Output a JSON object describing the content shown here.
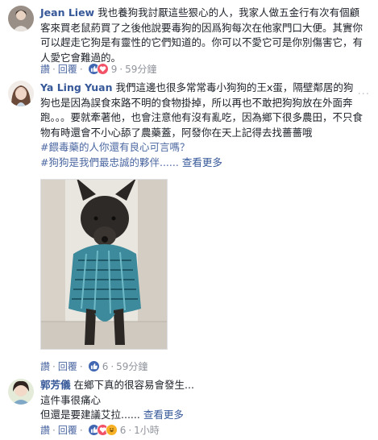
{
  "comments": [
    {
      "author": "Jean Liew",
      "text": "我也養狗我討厭這些狠心的人，我家人做五金行有次有個顧客來買老鼠葯買了之後他說要毒狗的因爲狗每次在他家門口大便。其實你可以趕走它狗是有靈性的它們知道的。你可以不愛它可是你別傷害它，有人愛它會難過的。",
      "like": "讚",
      "reply": "回覆",
      "reaction_count": "9",
      "time": "59分鐘"
    },
    {
      "author": "Ya Ling Yuan",
      "text": "我們這邊也很多常常毒小狗狗的王x蛋，隔壁鄰居的狗狗也是因為誤食來路不明的食物掛掉，所以再也不敢把狗狗放在外面奔跑。。。要就牽著他，也會注意他有沒有亂吃，因為鄉下很多農田，不只食物有時還會不小心舔了農藥蓋，阿發你在天上記得去找薔薔哦",
      "hashtag1": "#餵毒藥的人你還有良心可言嗎？",
      "hashtag2": "#狗狗是我們最忠誠的夥伴......",
      "see_more": "查看更多",
      "like": "讚",
      "reply": "回覆",
      "reaction_count": "6",
      "time": "59分鐘"
    },
    {
      "author": "郭芳儀",
      "line1": "在鄉下真的很容易會發生...",
      "line2": "這件事很痛心",
      "line3": "但還是要建議艾拉......",
      "see_more": "查看更多",
      "like": "讚",
      "reply": "回覆",
      "reaction_count": "6",
      "time": "1小時"
    }
  ],
  "menu": "···",
  "colors": {
    "link": "#365899",
    "muted": "#90949c",
    "like": "#4267b2",
    "love": "#f25268",
    "haha": "#f7b125"
  },
  "icons": [
    "like-reaction-icon",
    "love-reaction-icon",
    "haha-reaction-icon",
    "more-options-icon"
  ]
}
